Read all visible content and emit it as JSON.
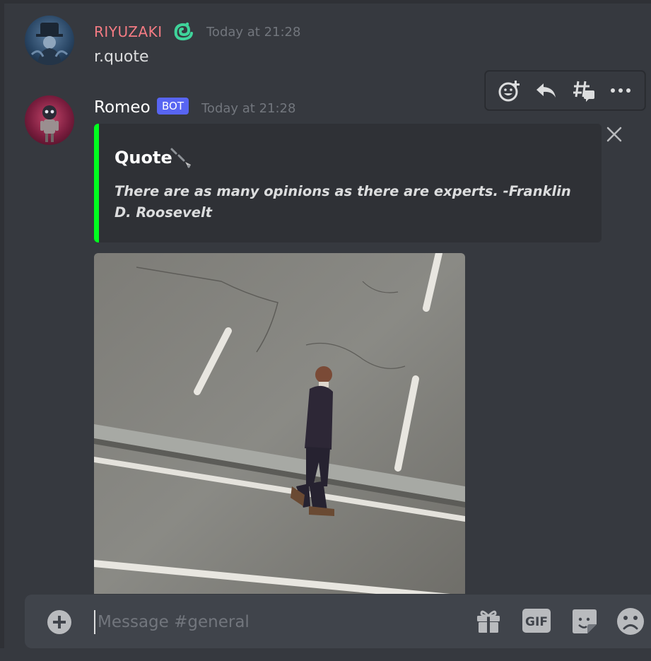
{
  "messages": [
    {
      "author": "RIYUZAKI",
      "author_color": "#f47b83",
      "timestamp": "Today at 21:28",
      "content": "r.quote"
    },
    {
      "author": "Romeo",
      "badge": "BOT",
      "timestamp": "Today at 21:28",
      "embed": {
        "title": "Quote",
        "description": "There are as many opinions as there are experts. -Franklin D. Roosevelt",
        "accent_color": "#00ff1e"
      }
    }
  ],
  "toolbar": {
    "icons": [
      "add-reaction-icon",
      "reply-icon",
      "create-thread-icon",
      "more-icon"
    ]
  },
  "composer": {
    "placeholder": "Message #general",
    "icons": [
      "gift-icon",
      "gif-icon",
      "sticker-icon",
      "emoji-icon"
    ],
    "gif_label": "GIF"
  },
  "colors": {
    "background": "#36393f",
    "embed_bg": "#2f3136",
    "bot_badge": "#5865f2",
    "composer_bg": "#40444b"
  }
}
